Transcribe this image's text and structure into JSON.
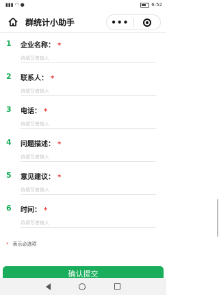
{
  "statusbar": {
    "time": "6:52"
  },
  "navbar": {
    "title": "群统计小助手"
  },
  "questions": [
    {
      "num": "1",
      "label": "企业名称：",
      "required": "*",
      "placeholder": "待填写者输入"
    },
    {
      "num": "2",
      "label": "联系人：",
      "required": "*",
      "placeholder": "待填写者输入"
    },
    {
      "num": "3",
      "label": "电话：",
      "required": "*",
      "placeholder": "待填写者输入"
    },
    {
      "num": "4",
      "label": "问题描述：",
      "required": "*",
      "placeholder": "待填写者输入"
    },
    {
      "num": "5",
      "label": "意见建议：",
      "required": "*",
      "placeholder": "待填写者输入"
    },
    {
      "num": "6",
      "label": "时间：",
      "required": "*",
      "placeholder": "待填写者输入"
    }
  ],
  "note": {
    "star": "*",
    "text": "表示必选项"
  },
  "submit_label": "确认提交",
  "colors": {
    "accent": "#1aad5b",
    "required": "#e53935"
  }
}
